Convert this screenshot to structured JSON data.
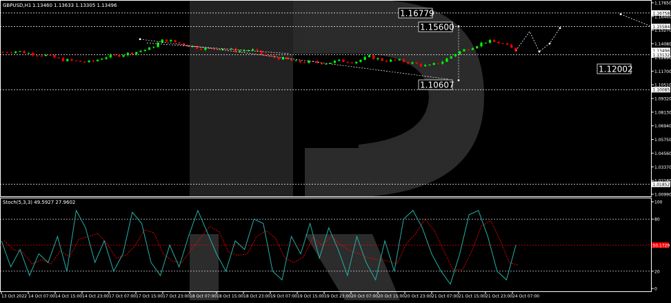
{
  "header": {
    "symbol_label": "GBPUSD,H1",
    "ohlc_label": "1.13460 1.13633 1.13305 1.13496"
  },
  "price_axis": {
    "labels": [
      "1.17650",
      "1.16460",
      "1.15270",
      "1.14080",
      "1.12890",
      "1.11700",
      "1.10510",
      "1.09320",
      "1.08130",
      "1.06940",
      "1.05750",
      "1.04560",
      "1.03370",
      "1.02180",
      "1.00990"
    ],
    "tags": [
      {
        "text": "1.16758",
        "price": 1.16758
      },
      {
        "text": "1.15584",
        "price": 1.15584
      },
      {
        "text": "1.13496",
        "price": 1.13496
      },
      {
        "text": "1.13132",
        "price": 1.13132
      },
      {
        "text": "1.10085",
        "price": 1.10085
      },
      {
        "text": "1.01852",
        "price": 1.01852
      }
    ]
  },
  "levels": [
    {
      "text": "1.16779",
      "price": 1.16758,
      "box_left": true
    },
    {
      "text": "1.15600",
      "price": 1.15584,
      "box_left": true
    },
    {
      "text": "1.10607",
      "price": 1.10085,
      "box_left": true
    },
    {
      "text": "1.12002",
      "price": 1.13132,
      "box_left": false
    }
  ],
  "time_axis": {
    "labels": [
      "13 Oct 2022",
      "14 Oct 07:00",
      "14 Oct 15:00",
      "14 Oct 23:00",
      "17 Oct 07:00",
      "17 Oct 15:00",
      "17 Oct 23:00",
      "18 Oct 07:00",
      "18 Oct 15:00",
      "18 Oct 23:00",
      "19 Oct 07:00",
      "19 Oct 15:00",
      "19 Oct 23:00",
      "20 Oct 07:00",
      "20 Oct 15:00",
      "20 Oct 23:00",
      "21 Oct 07:00",
      "21 Oct 15:00",
      "21 Oct 23:00",
      "24 Oct 07:00"
    ]
  },
  "indicator": {
    "label": "Stoch(5,3,3) 49.5927 27.9602",
    "axis_labels": [
      "100",
      "80",
      "20",
      "0"
    ],
    "level_tag": "50.1729",
    "levels": [
      80,
      50,
      20
    ]
  },
  "colors": {
    "bull": "#00ff00",
    "bear": "#ff0000",
    "grid": "#ffffff",
    "text": "#ffffff",
    "stoch_main": "#20b2aa",
    "stoch_signal": "#ff0000",
    "watermark": "#3a3a3a"
  },
  "chart_data": {
    "type": "line",
    "series": [
      {
        "name": "",
        "price_path": [
          1.1335,
          1.1345,
          1.132,
          1.1305,
          1.127,
          1.1255,
          1.1248,
          1.1295,
          1.131,
          1.1335,
          1.1365,
          1.1445,
          1.1415,
          1.138,
          1.136,
          1.137,
          1.1345,
          1.1355,
          1.13,
          1.128,
          1.125,
          1.1248,
          1.124,
          1.126,
          1.125,
          1.1295,
          1.1262,
          1.1262,
          1.1238,
          1.121,
          1.1255,
          1.1332,
          1.138,
          1.143,
          1.1415,
          1.1348
        ]
      }
    ],
    "projection": [
      1.1348,
      1.136,
      1.1515,
      1.134,
      1.1545,
      1.162
    ]
  }
}
